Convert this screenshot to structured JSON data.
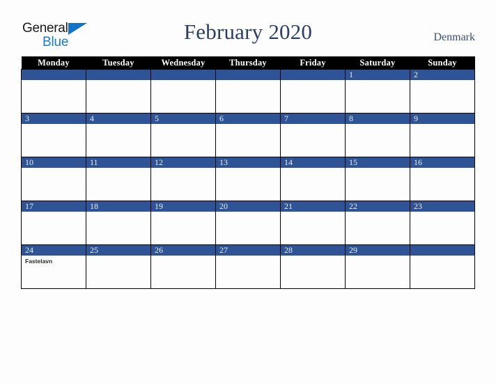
{
  "brand": {
    "line1": "General",
    "line2": "Blue",
    "triangle_color": "#1473c6",
    "line2_color": "#1a7bc9"
  },
  "header": {
    "title": "February 2020",
    "country": "Denmark",
    "title_color": "#2c3f63"
  },
  "calendar": {
    "accent_color": "#2f5496",
    "header_bg": "#000000",
    "weekday_headers": [
      "Monday",
      "Tuesday",
      "Wednesday",
      "Thursday",
      "Friday",
      "Saturday",
      "Sunday"
    ],
    "weeks": [
      [
        {
          "date": "",
          "events": []
        },
        {
          "date": "",
          "events": []
        },
        {
          "date": "",
          "events": []
        },
        {
          "date": "",
          "events": []
        },
        {
          "date": "",
          "events": []
        },
        {
          "date": "1",
          "events": []
        },
        {
          "date": "2",
          "events": []
        }
      ],
      [
        {
          "date": "3",
          "events": []
        },
        {
          "date": "4",
          "events": []
        },
        {
          "date": "5",
          "events": []
        },
        {
          "date": "6",
          "events": []
        },
        {
          "date": "7",
          "events": []
        },
        {
          "date": "8",
          "events": []
        },
        {
          "date": "9",
          "events": []
        }
      ],
      [
        {
          "date": "10",
          "events": []
        },
        {
          "date": "11",
          "events": []
        },
        {
          "date": "12",
          "events": []
        },
        {
          "date": "13",
          "events": []
        },
        {
          "date": "14",
          "events": []
        },
        {
          "date": "15",
          "events": []
        },
        {
          "date": "16",
          "events": []
        }
      ],
      [
        {
          "date": "17",
          "events": []
        },
        {
          "date": "18",
          "events": []
        },
        {
          "date": "19",
          "events": []
        },
        {
          "date": "20",
          "events": []
        },
        {
          "date": "21",
          "events": []
        },
        {
          "date": "22",
          "events": []
        },
        {
          "date": "23",
          "events": []
        }
      ],
      [
        {
          "date": "24",
          "events": [
            "Fastelavn"
          ]
        },
        {
          "date": "25",
          "events": []
        },
        {
          "date": "26",
          "events": []
        },
        {
          "date": "27",
          "events": []
        },
        {
          "date": "28",
          "events": []
        },
        {
          "date": "29",
          "events": []
        },
        {
          "date": "",
          "events": []
        }
      ]
    ]
  }
}
